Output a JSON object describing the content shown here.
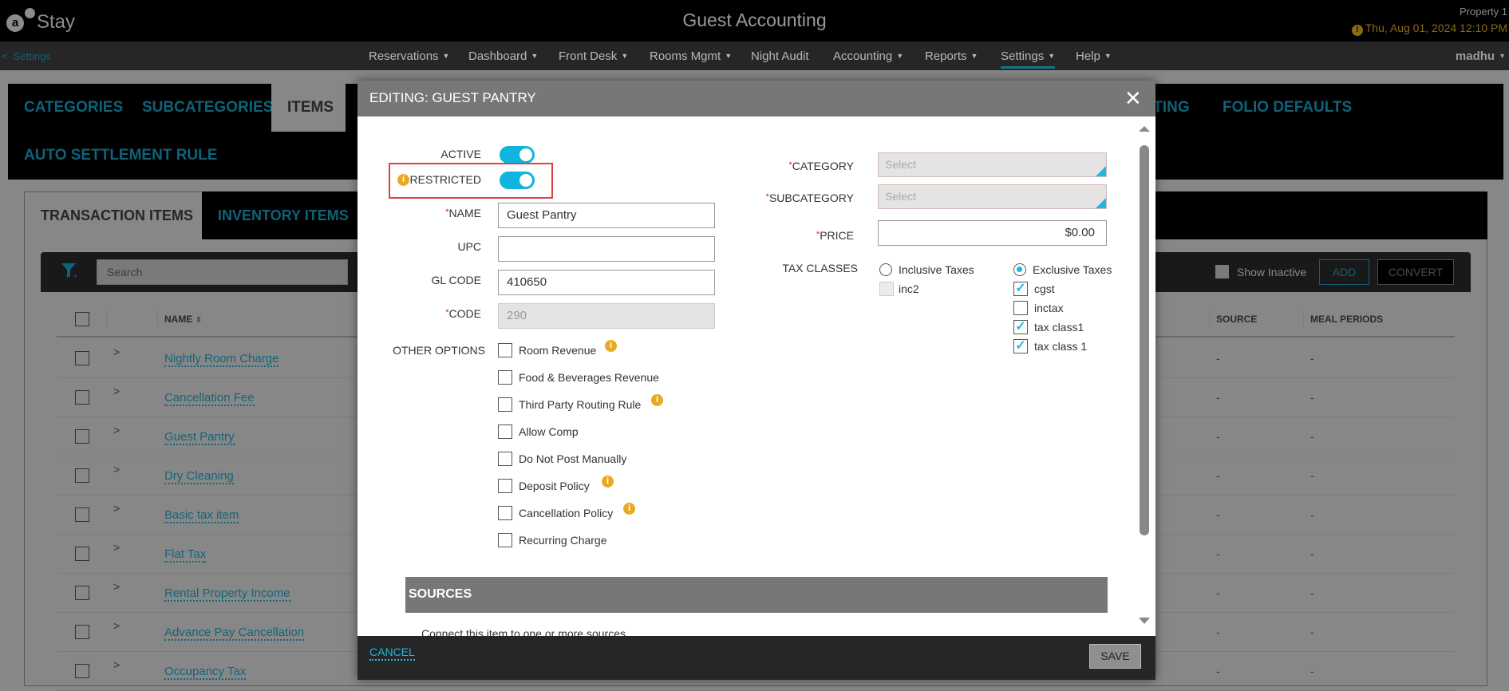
{
  "header": {
    "logo_text": "Stay",
    "title": "Guest Accounting",
    "property": "Property 1",
    "datetime": "Thu, Aug 01, 2024 12:10 PM",
    "user": "madhu"
  },
  "nav": {
    "back_label": "Settings",
    "items": [
      {
        "label": "Reservations",
        "dropdown": true
      },
      {
        "label": "Dashboard",
        "dropdown": true
      },
      {
        "label": "Front Desk",
        "dropdown": true
      },
      {
        "label": "Rooms Mgmt",
        "dropdown": true
      },
      {
        "label": "Night Audit",
        "dropdown": false
      },
      {
        "label": "Accounting",
        "dropdown": true
      },
      {
        "label": "Reports",
        "dropdown": true
      },
      {
        "label": "Settings",
        "dropdown": true,
        "active": true
      },
      {
        "label": "Help",
        "dropdown": true
      }
    ]
  },
  "section_tabs": {
    "items": [
      "CATEGORIES",
      "SUBCATEGORIES",
      "ITEMS",
      "AUTO SETTLEMENT RULE"
    ],
    "partial_visible": [
      "ITING",
      "FOLIO DEFAULTS"
    ],
    "active": "ITEMS"
  },
  "item_tabs": {
    "items": [
      "TRANSACTION ITEMS",
      "INVENTORY ITEMS"
    ],
    "active": "TRANSACTION ITEMS"
  },
  "toolbar": {
    "search_placeholder": "Search",
    "show_inactive_label": "Show Inactive",
    "show_inactive_checked": false,
    "add_label": "ADD",
    "convert_label": "CONVERT"
  },
  "table": {
    "columns": {
      "name": "NAME",
      "source": "SOURCE",
      "meal_periods": "MEAL PERIODS"
    },
    "rows": [
      {
        "name": "Nightly Room Charge",
        "source": "-",
        "meal_periods": "-"
      },
      {
        "name": "Cancellation Fee",
        "source": "-",
        "meal_periods": "-"
      },
      {
        "name": "Guest Pantry",
        "source": "-",
        "meal_periods": "-"
      },
      {
        "name": "Dry Cleaning",
        "source": "-",
        "meal_periods": "-"
      },
      {
        "name": "Basic tax item",
        "source": "-",
        "meal_periods": "-"
      },
      {
        "name": "Flat Tax",
        "source": "-",
        "meal_periods": "-"
      },
      {
        "name": "Rental Property Income",
        "source": "-",
        "meal_periods": "-"
      },
      {
        "name": "Advance Pay Cancellation",
        "source": "-",
        "meal_periods": "-"
      },
      {
        "name": "Occupancy Tax",
        "source": "-",
        "meal_periods": "-"
      }
    ]
  },
  "modal": {
    "title": "EDITING: GUEST PANTRY",
    "active_label": "ACTIVE",
    "active_on": true,
    "restricted_label": "RESTRICTED",
    "restricted_on": true,
    "name_label": "NAME",
    "name_value": "Guest Pantry",
    "upc_label": "UPC",
    "upc_value": "",
    "gl_code_label": "GL CODE",
    "gl_code_value": "410650",
    "code_label": "CODE",
    "code_value": "290",
    "other_options_label": "OTHER OPTIONS",
    "options": [
      {
        "label": "Room Revenue",
        "checked": false,
        "info": true
      },
      {
        "label": "Food & Beverages Revenue",
        "checked": false,
        "info": false
      },
      {
        "label": "Third Party Routing Rule",
        "checked": false,
        "info": true
      },
      {
        "label": "Allow Comp",
        "checked": false,
        "info": false
      },
      {
        "label": "Do Not Post Manually",
        "checked": false,
        "info": false
      },
      {
        "label": "Deposit Policy",
        "checked": false,
        "info": true
      },
      {
        "label": "Cancellation Policy",
        "checked": false,
        "info": true
      },
      {
        "label": "Recurring Charge",
        "checked": false,
        "info": false
      }
    ],
    "category_label": "CATEGORY",
    "category_placeholder": "Select",
    "subcategory_label": "SUBCATEGORY",
    "subcategory_placeholder": "Select",
    "price_label": "PRICE",
    "price_value": "$0.00",
    "tax_classes_label": "TAX CLASSES",
    "inclusive": {
      "label": "Inclusive Taxes",
      "selected": false,
      "items": [
        {
          "label": "inc2",
          "checked": false,
          "disabled": true
        }
      ]
    },
    "exclusive": {
      "label": "Exclusive Taxes",
      "selected": true,
      "items": [
        {
          "label": "cgst",
          "checked": true
        },
        {
          "label": "inctax",
          "checked": false
        },
        {
          "label": "tax class1",
          "checked": true
        },
        {
          "label": "tax class 1",
          "checked": true
        }
      ]
    },
    "sources_title": "SOURCES",
    "sources_desc": "Connect this item to one or more sources",
    "cancel_label": "CANCEL",
    "save_label": "SAVE"
  },
  "colors": {
    "accent": "#0fb5e0",
    "highlight_box": "#e04040",
    "info": "#eaa925"
  }
}
